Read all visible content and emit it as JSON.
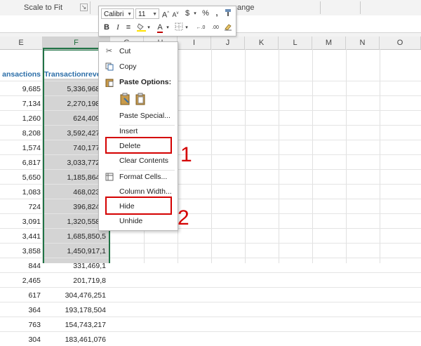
{
  "ribbon": {
    "group_scale": "Scale to Fit",
    "group_arrange_partial": "ange"
  },
  "columns": [
    "E",
    "F",
    "G",
    "H",
    "I",
    "J",
    "K",
    "L",
    "M",
    "N",
    "O"
  ],
  "table": {
    "header_e": "ansactions",
    "header_f": "Transactionreve",
    "rows": [
      {
        "e": "9,685",
        "f": "5,336,968,9"
      },
      {
        "e": "7,134",
        "f": "2,270,198,6"
      },
      {
        "e": "1,260",
        "f": "624,409,8"
      },
      {
        "e": "8,208",
        "f": "3,592,427,4"
      },
      {
        "e": "1,574",
        "f": "740,177,2"
      },
      {
        "e": "6,817",
        "f": "3,033,772,5"
      },
      {
        "e": "5,650",
        "f": "1,185,864,6"
      },
      {
        "e": "1,083",
        "f": "468,023,5"
      },
      {
        "e": "724",
        "f": "396,824,6"
      },
      {
        "e": "3,091",
        "f": "1,320,558,6"
      },
      {
        "e": "3,441",
        "f": "1,685,850,5"
      },
      {
        "e": "3,858",
        "f": "1,450,917,1"
      },
      {
        "e": "844",
        "f": "331,469,1"
      },
      {
        "e": "2,465",
        "f": "201,719,8"
      },
      {
        "e": "617",
        "f": "304,476,251"
      },
      {
        "e": "364",
        "f": "193,178,504"
      },
      {
        "e": "763",
        "f": "154,743,217"
      },
      {
        "e": "304",
        "f": "183,461,076"
      }
    ]
  },
  "mini_toolbar": {
    "font": "Calibri",
    "size": "11",
    "grow_font": "A",
    "shrink_font": "A",
    "currency": "$",
    "percent": "%",
    "comma": ",",
    "bold": "B",
    "italic": "I",
    "align": "≡",
    "font_color_letter": "A",
    "dec_increase": "←.0",
    "dec_decrease": ".00"
  },
  "context_menu": {
    "cut": "Cut",
    "copy": "Copy",
    "paste_options": "Paste Options:",
    "paste_special": "Paste Special...",
    "insert": "Insert",
    "delete": "Delete",
    "clear_contents": "Clear Contents",
    "format_cells": "Format Cells...",
    "column_width": "Column Width...",
    "hide": "Hide",
    "unhide": "Unhide"
  },
  "annotations": {
    "step1": "1",
    "step2": "2"
  },
  "colors": {
    "accent_green": "#217346",
    "annotation_red": "#d40000",
    "header_blue": "#2b6ea8"
  }
}
